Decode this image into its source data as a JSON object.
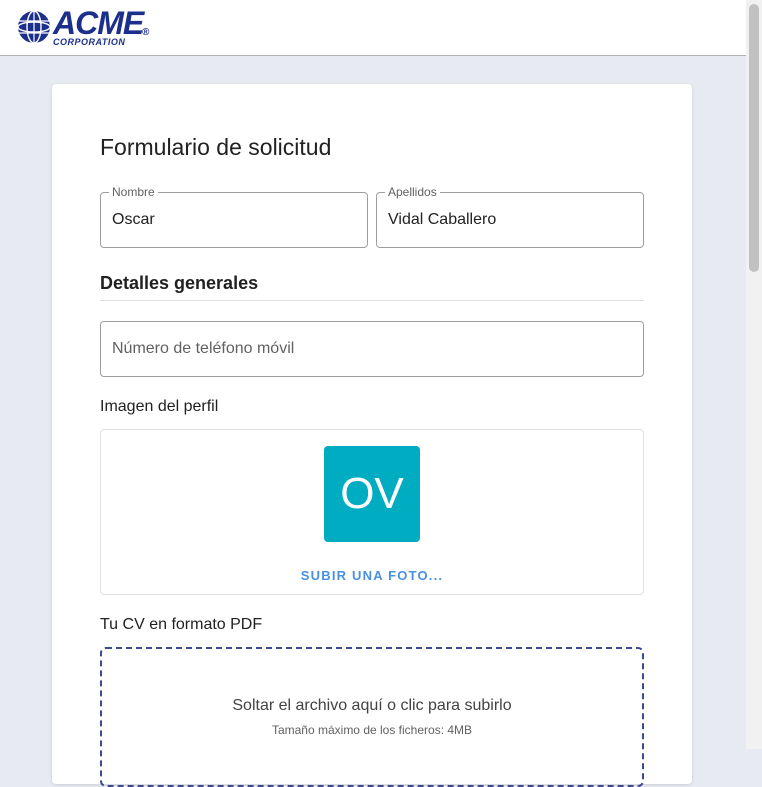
{
  "header": {
    "logo_word": "ACME",
    "logo_sub": "CORPORATION",
    "logo_reg": "®"
  },
  "form": {
    "title": "Formulario de solicitud",
    "first_name": {
      "label": "Nombre",
      "value": "Oscar"
    },
    "last_name": {
      "label": "Apellidos",
      "value": "Vidal Caballero"
    },
    "section_general": "Detalles generales",
    "phone": {
      "placeholder": "Número de teléfono móvil",
      "value": ""
    },
    "profile_image": {
      "label": "Imagen del perfil",
      "initials": "OV",
      "avatar_color": "#00acc1",
      "upload_label": "SUBIR UNA FOTO..."
    },
    "cv": {
      "label": "Tu CV en formato PDF",
      "drop_text": "Soltar el archivo aquí o clic para subirlo",
      "max_size": "Tamaño máximo de los ficheros: 4MB"
    }
  },
  "colors": {
    "brand": "#1c2f8c",
    "link": "#4a90e2",
    "background": "#e8eaf2"
  }
}
